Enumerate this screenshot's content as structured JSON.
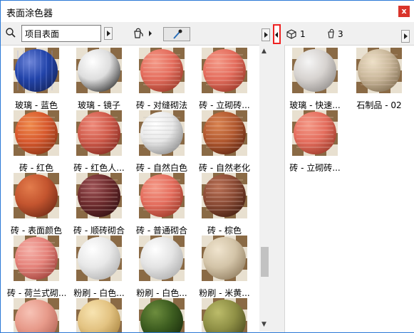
{
  "window": {
    "title": "表面涂色器",
    "close_label": "x"
  },
  "toolbar": {
    "search_value": "项目表面"
  },
  "right_header": {
    "objects_count": "1",
    "paints_count": "3"
  },
  "materials": [
    {
      "label": "玻璃 - 蓝色",
      "kind": "glass-blue"
    },
    {
      "label": "玻璃 - 镜子",
      "kind": "mirror"
    },
    {
      "label": "砖 - 对缝砌法",
      "kind": "brick-salmon"
    },
    {
      "label": "砖 - 立砌砖...",
      "kind": "brick-salmon"
    },
    {
      "label": "砖 - 红色",
      "kind": "brick-orange"
    },
    {
      "label": "砖 - 红色人...",
      "kind": "brick-herring"
    },
    {
      "label": "砖 - 自然白色",
      "kind": "brick-white"
    },
    {
      "label": "砖 - 自然老化",
      "kind": "brick-aged"
    },
    {
      "label": "砖 - 表面颜色",
      "kind": "rough-orange"
    },
    {
      "label": "砖 - 顺砖砌合",
      "kind": "brick-dark"
    },
    {
      "label": "砖 - 普通砌合",
      "kind": "brick-salmon"
    },
    {
      "label": "砖 - 棕色",
      "kind": "brick-brown"
    },
    {
      "label": "砖 - 荷兰式砌...",
      "kind": "brick-pink"
    },
    {
      "label": "粉刷 - 白色...",
      "kind": "plaster-white"
    },
    {
      "label": "粉刷 - 白色...",
      "kind": "plaster-white2"
    },
    {
      "label": "粉刷 - 米黄...",
      "kind": "plaster-beige"
    },
    {
      "label": "",
      "kind": "pink"
    },
    {
      "label": "",
      "kind": "yellow"
    },
    {
      "label": "",
      "kind": "moss"
    },
    {
      "label": "",
      "kind": "grass"
    }
  ],
  "project_materials": [
    {
      "label": "玻璃 - 快速...",
      "kind": "glass-clear"
    },
    {
      "label": "石制品 - 02",
      "kind": "stone"
    },
    {
      "label": "砖 - 立砌砖...",
      "kind": "brick-salmon"
    }
  ]
}
